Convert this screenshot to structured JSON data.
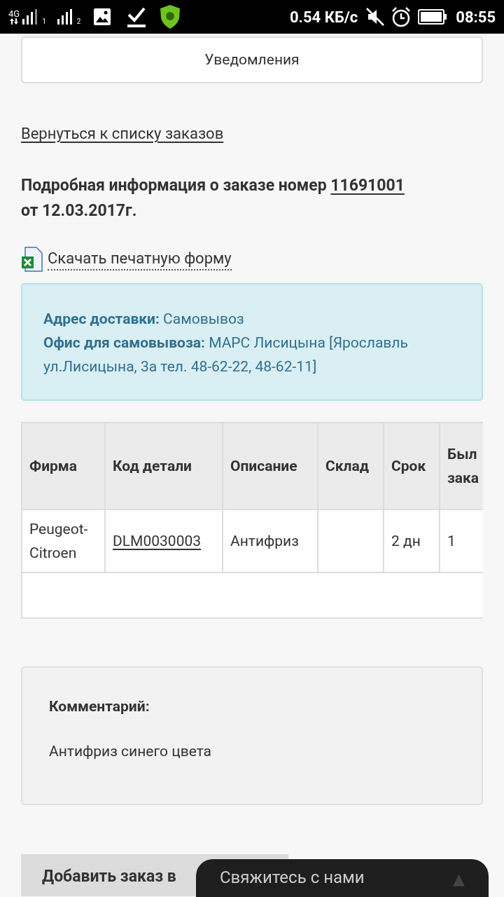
{
  "status_bar": {
    "network": "4G",
    "sim_1": "1",
    "sim_2": "2",
    "speed": "0.54 КБ/с",
    "time": "08:55"
  },
  "notifications_button": "Уведомления",
  "back_link": "Вернуться к списку заказов",
  "heading": {
    "text": "Подробная информация о заказе номер",
    "order_number": "11691001",
    "date": "от 12.03.2017г."
  },
  "download_link": "Скачать печатную форму",
  "delivery": [
    "**Адрес доставки:** Самовывоз",
    "**Офис для самовывоза:** МАРС Лисицына [Ярославль ул.Лисицына, 3а тел. 48-62-22, 48-62-11]"
  ],
  "table": {
    "columns": [
      "Фирма",
      "Код детали",
      "Описание",
      "Склад",
      "Срок",
      "Был зака"
    ],
    "rows": [
      [
        "Peugeot-Citroen",
        "DLM0030003",
        "Антифриз",
        "",
        "2 дн",
        "1"
      ]
    ]
  },
  "comment": {
    "title": "Комментарий:",
    "text": "Антифриз синего цвета"
  },
  "add_button": "Добавить заказ в",
  "chat_bar": {
    "label": "Свяжитесь с нами",
    "arrow": "▲"
  }
}
